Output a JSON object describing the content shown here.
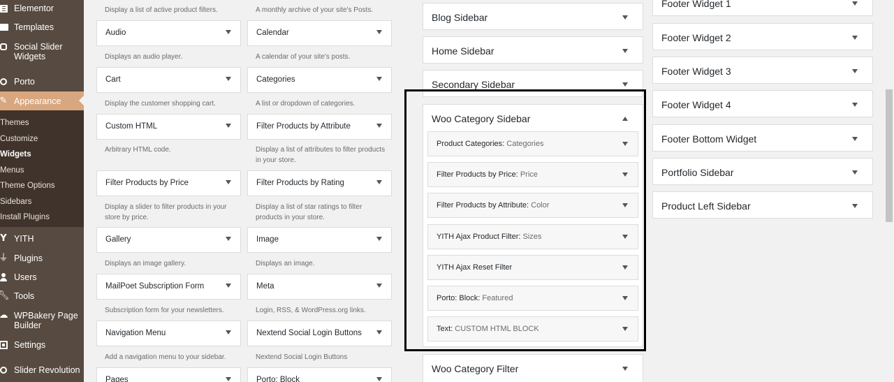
{
  "admin_menu": {
    "items": [
      {
        "label": "Elementor",
        "icon": "elementor-icon"
      },
      {
        "label": "Templates",
        "icon": "folder-icon"
      },
      {
        "label": "Social Slider Widgets",
        "icon": "camera-icon"
      },
      {
        "label": "Porto",
        "icon": "circle-icon"
      },
      {
        "label": "Appearance",
        "icon": "paintbrush-icon"
      },
      {
        "label": "YITH",
        "icon": "yith-icon"
      },
      {
        "label": "Plugins",
        "icon": "plug-icon"
      },
      {
        "label": "Users",
        "icon": "user-icon"
      },
      {
        "label": "Tools",
        "icon": "wrench-icon"
      },
      {
        "label": "WPBakery Page Builder",
        "icon": "wpbakery-icon"
      },
      {
        "label": "Settings",
        "icon": "settings-icon"
      },
      {
        "label": "Slider Revolution",
        "icon": "refresh-icon"
      }
    ],
    "submenu": [
      {
        "label": "Themes"
      },
      {
        "label": "Customize"
      },
      {
        "label": "Widgets"
      },
      {
        "label": "Menus"
      },
      {
        "label": "Theme Options"
      },
      {
        "label": "Sidebars"
      },
      {
        "label": "Install Plugins"
      }
    ],
    "colors": {
      "background": "#574a40",
      "current": "#d9a77f",
      "submenu": "#3f332b"
    }
  },
  "available_widgets": {
    "top_descriptions": [
      "Display a list of active product filters.",
      "A monthly archive of your site's Posts."
    ],
    "rows": [
      [
        {
          "title": "Audio",
          "desc": "Displays an audio player."
        },
        {
          "title": "Calendar",
          "desc": "A calendar of your site's posts."
        }
      ],
      [
        {
          "title": "Cart",
          "desc": "Display the customer shopping cart."
        },
        {
          "title": "Categories",
          "desc": "A list or dropdown of categories."
        }
      ],
      [
        {
          "title": "Custom HTML",
          "desc": "Arbitrary HTML code."
        },
        {
          "title": "Filter Products by Attribute",
          "desc": "Display a list of attributes to filter products in your store."
        }
      ],
      [
        {
          "title": "Filter Products by Price",
          "desc": "Display a slider to filter products in your store by price."
        },
        {
          "title": "Filter Products by Rating",
          "desc": "Display a list of star ratings to filter products in your store."
        }
      ],
      [
        {
          "title": "Gallery",
          "desc": "Displays an image gallery."
        },
        {
          "title": "Image",
          "desc": "Displays an image."
        }
      ],
      [
        {
          "title": "MailPoet Subscription Form",
          "desc": "Subscription form for your newsletters."
        },
        {
          "title": "Meta",
          "desc": "Login, RSS, & WordPress.org links."
        }
      ],
      [
        {
          "title": "Navigation Menu",
          "desc": "Add a navigation menu to your sidebar."
        },
        {
          "title": "Nextend Social Login Buttons",
          "desc": "Nextend Social Login Buttons"
        }
      ],
      [
        {
          "title": "Pages",
          "desc": ""
        },
        {
          "title": "Porto: Block",
          "desc": ""
        }
      ]
    ]
  },
  "sidebars_col1": [
    {
      "title": "Blog Sidebar"
    },
    {
      "title": "Home Sidebar"
    },
    {
      "title": "Secondary Sidebar"
    }
  ],
  "woo_category_sidebar": {
    "title": "Woo Category Sidebar",
    "widgets": [
      {
        "name": "Product Categories:",
        "subtitle": "Categories"
      },
      {
        "name": "Filter Products by Price:",
        "subtitle": "Price"
      },
      {
        "name": "Filter Products by Attribute:",
        "subtitle": "Color"
      },
      {
        "name": "YITH Ajax Product Filter:",
        "subtitle": "Sizes"
      },
      {
        "name": "YITH Ajax Reset Filter",
        "subtitle": ""
      },
      {
        "name": "Porto: Block:",
        "subtitle": "Featured"
      },
      {
        "name": "Text:",
        "subtitle": "CUSTOM HTML BLOCK"
      }
    ]
  },
  "woo_category_filter": {
    "title": "Woo Category Filter"
  },
  "sidebars_col2": [
    {
      "title": "Footer Widget 1"
    },
    {
      "title": "Footer Widget 2"
    },
    {
      "title": "Footer Widget 3"
    },
    {
      "title": "Footer Widget 4"
    },
    {
      "title": "Footer Bottom Widget"
    },
    {
      "title": "Portfolio Sidebar"
    },
    {
      "title": "Product Left Sidebar"
    }
  ]
}
